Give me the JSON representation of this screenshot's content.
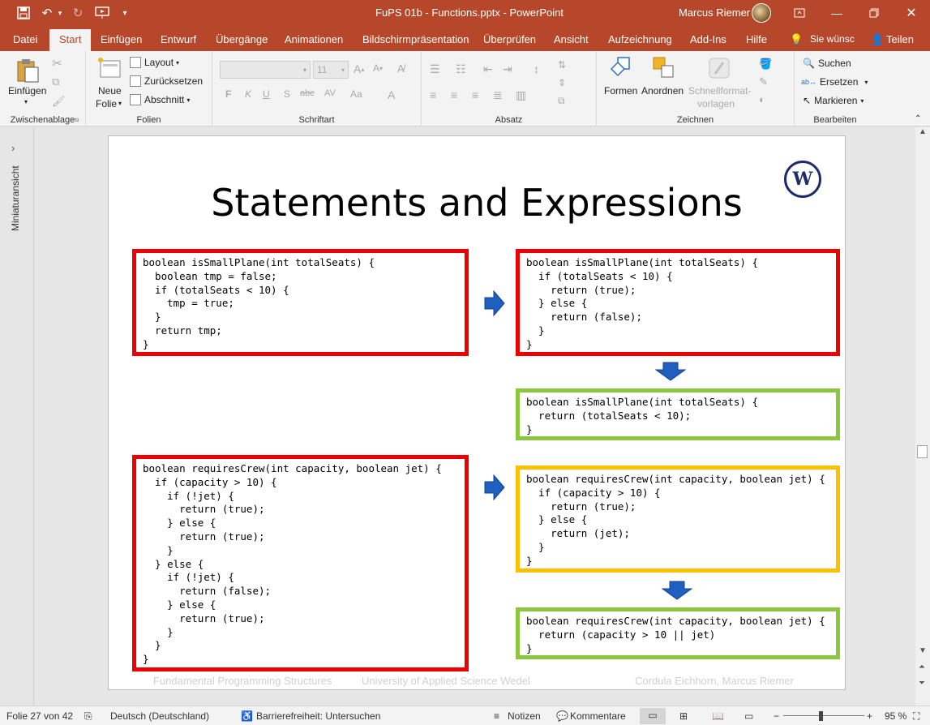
{
  "titlebar": {
    "title": "FuPS 01b - Functions.pptx  -  PowerPoint",
    "user": "Marcus Riemer",
    "bg_color": "#b7472a"
  },
  "menu": {
    "tabs": [
      "Datei",
      "Start",
      "Einfügen",
      "Entwurf",
      "Übergänge",
      "Animationen",
      "Bildschirmpräsentation",
      "Überprüfen",
      "Ansicht",
      "Aufzeichnung",
      "Add-Ins",
      "Hilfe"
    ],
    "active": "Start",
    "search": "Sie wünsc",
    "share": "Teilen"
  },
  "ribbon": {
    "clipboard": {
      "paste": "Einfügen",
      "label": "Zwischenablage"
    },
    "slides": {
      "new_line1": "Neue",
      "new_line2": "Folie",
      "layout": "Layout",
      "reset": "Zurücksetzen",
      "section": "Abschnitt",
      "label": "Folien"
    },
    "font": {
      "size": "11",
      "bold": "F",
      "italic": "K",
      "underline": "U",
      "shadow": "S",
      "strike": "abc",
      "spacing": "AV",
      "case": "Aa",
      "color": "A",
      "label": "Schriftart"
    },
    "paragraph": {
      "label": "Absatz"
    },
    "drawing": {
      "shapes": "Formen",
      "arrange": "Anordnen",
      "quickstyles_line1": "Schnellformat-",
      "quickstyles_line2": "vorlagen",
      "label": "Zeichnen"
    },
    "editing": {
      "find": "Suchen",
      "replace": "Ersetzen",
      "select": "Markieren",
      "label": "Bearbeiten"
    }
  },
  "leftstrip": {
    "label": "Miniaturansicht"
  },
  "slide": {
    "title": "Statements and Expressions",
    "logo_text": "W",
    "code_blocks": [
      "boolean isSmallPlane(int totalSeats) {\n  boolean tmp = false;\n  if (totalSeats < 10) {\n    tmp = true;\n  }\n  return tmp;\n}",
      "boolean isSmallPlane(int totalSeats) {\n  if (totalSeats < 10) {\n    return (true);\n  } else {\n    return (false);\n  }\n}",
      "boolean isSmallPlane(int totalSeats) {\n  return (totalSeats < 10);\n}",
      "boolean requiresCrew(int capacity, boolean jet) {\n  if (capacity > 10) {\n    if (!jet) {\n      return (true);\n    } else {\n      return (true);\n    }\n  } else {\n    if (!jet) {\n      return (false);\n    } else {\n      return (true);\n    }\n  }\n}",
      "boolean requiresCrew(int capacity, boolean jet) {\n  if (capacity > 10) {\n    return (true);\n  } else {\n    return (jet);\n  }\n}",
      "boolean requiresCrew(int capacity, boolean jet) {\n  return (capacity > 10 || jet)\n}"
    ],
    "footer": {
      "left": "Fundamental Programming Structures",
      "center": "University of Applied Science Wedel",
      "right": "Cordula Eichhorn, Marcus Riemer"
    },
    "colors": {
      "red": "#ee0000",
      "green": "#8cc63f",
      "yellow": "#ffc000",
      "arrow": "#1f5fbf"
    }
  },
  "statusbar": {
    "slide_info": "Folie 27 von 42",
    "language": "Deutsch (Deutschland)",
    "accessibility": "Barrierefreiheit: Untersuchen",
    "notes": "Notizen",
    "comments": "Kommentare",
    "zoom": "95 %"
  }
}
